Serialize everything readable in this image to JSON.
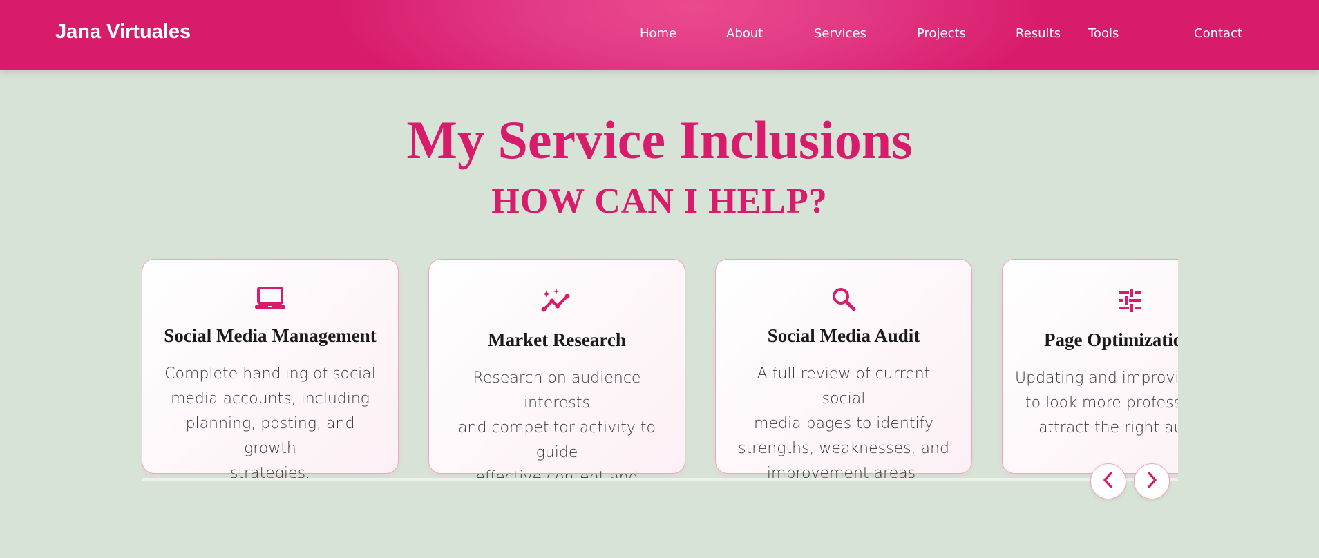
{
  "brand": "Jana Virtuales",
  "nav": [
    "Home",
    "About",
    "Services",
    "Projects",
    "Results",
    "Tools",
    "Contact"
  ],
  "section": {
    "title": "My Service Inclusions",
    "subtitle": "HOW CAN I HELP?"
  },
  "cards": [
    {
      "icon": "laptop-icon",
      "title": "Social Media Management",
      "desc": [
        "Complete handling of social",
        "media accounts, including",
        "planning, posting, and growth",
        "strategies."
      ]
    },
    {
      "icon": "trending-sparkle-icon",
      "title": "Market Research",
      "desc": [
        "Research on audience interests",
        "and competitor activity to guide",
        "effective content and strategy."
      ]
    },
    {
      "icon": "search-icon",
      "title": "Social Media Audit",
      "desc": [
        "A full review of current social",
        "media pages to identify",
        "strengths, weaknesses, and",
        "improvement areas."
      ]
    },
    {
      "icon": "sliders-icon",
      "title": "Page Optimization",
      "desc": [
        "Updating and improving pages",
        "to look more professional and",
        "attract the right audience."
      ]
    }
  ],
  "controls": {
    "prev_icon": "chevron-left-icon",
    "next_icon": "chevron-right-icon"
  },
  "colors": {
    "accent": "#d81b6b",
    "background": "#d8e3d7",
    "card_border": "#f2a3c4"
  }
}
